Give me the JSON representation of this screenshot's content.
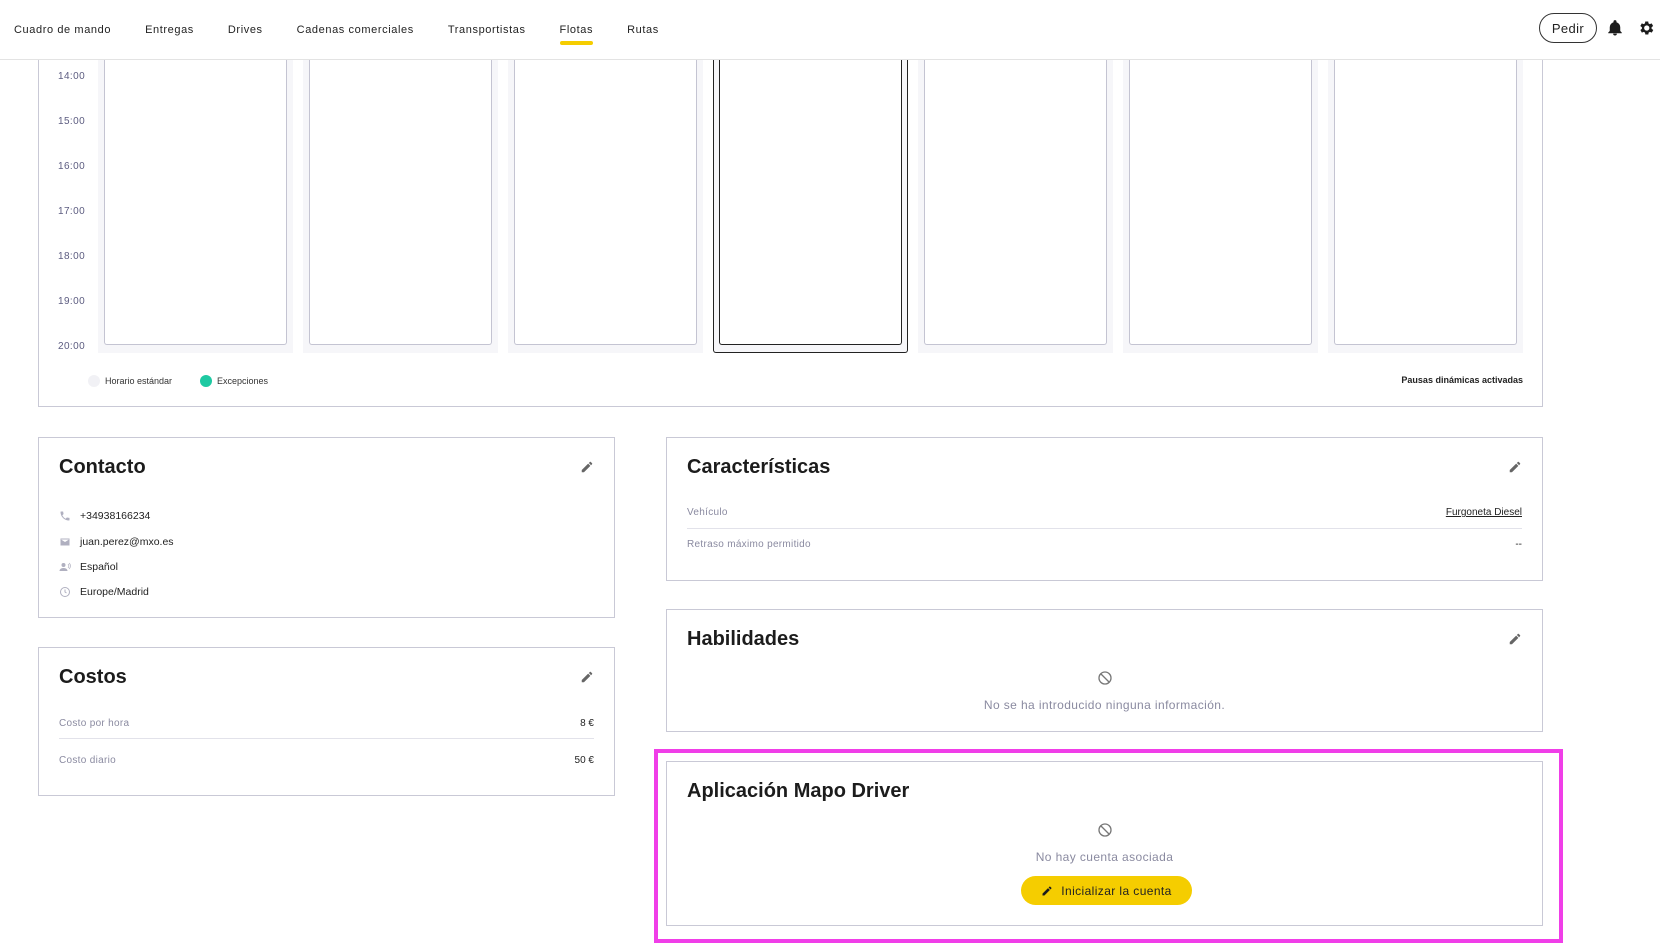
{
  "nav": {
    "items": [
      {
        "label": "Cuadro de mando",
        "active": false
      },
      {
        "label": "Entregas",
        "active": false
      },
      {
        "label": "Drives",
        "active": false
      },
      {
        "label": "Cadenas comerciales",
        "active": false
      },
      {
        "label": "Transportistas",
        "active": false
      },
      {
        "label": "Flotas",
        "active": true
      },
      {
        "label": "Rutas",
        "active": false
      }
    ],
    "accent_color": "#f5cd00",
    "order_button": "Pedir",
    "icons": [
      "bell-icon",
      "gear-icon"
    ]
  },
  "schedule": {
    "times": [
      "14:00",
      "15:00",
      "16:00",
      "17:00",
      "18:00",
      "19:00",
      "20:00"
    ],
    "selected_day_index": 3,
    "legend": {
      "standard": "Horario estándar",
      "standard_color": "#f1f1f5",
      "exceptions": "Excepciones",
      "exceptions_color": "#1ec9a2"
    },
    "pauses_label": "Pausas dinámicas activadas"
  },
  "contact": {
    "title": "Contacto",
    "phone": "+34938166234",
    "email": "juan.perez@mxo.es",
    "language": "Español",
    "timezone": "Europe/Madrid"
  },
  "costs": {
    "title": "Costos",
    "hourly_label": "Costo por hora",
    "hourly_value": "8 €",
    "daily_label": "Costo diario",
    "daily_value": "50 €"
  },
  "features": {
    "title": "Características",
    "vehicle_label": "Vehículo",
    "vehicle_value": "Furgoneta Diesel",
    "delay_label": "Retraso máximo permitido",
    "delay_value": "--"
  },
  "skills": {
    "title": "Habilidades",
    "empty_text": "No se ha introducido ninguna información."
  },
  "driver_app": {
    "title": "Aplicación Mapo Driver",
    "empty_text": "No hay cuenta asociada",
    "init_button": "Inicializar la cuenta"
  }
}
